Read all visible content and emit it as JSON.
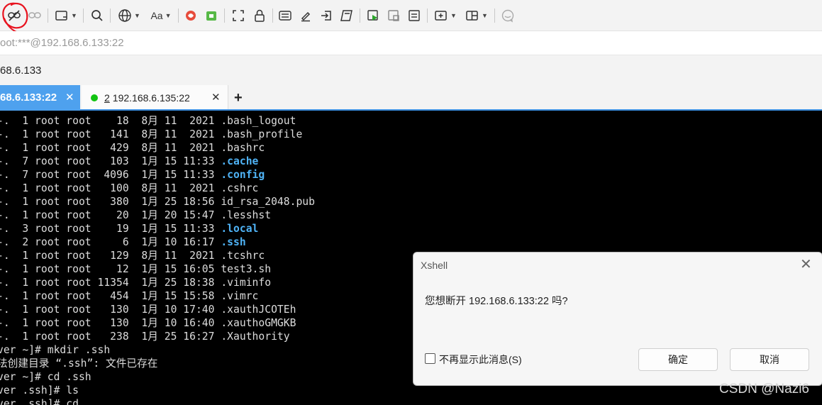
{
  "toolbar": {
    "font_button_label": "Aa"
  },
  "address_bar": {
    "text": "oot:***@192.168.6.133:22"
  },
  "host_bar": {
    "text": "68.6.133"
  },
  "tabs": [
    {
      "label": "68.6.133:22",
      "close": "✕"
    },
    {
      "index": "2",
      "label": "192.168.6.135:22",
      "close": "✕"
    }
  ],
  "new_tab": "+",
  "terminal": {
    "lines": [
      "-.  1 root root    18  8月 11  2021 .bash_logout",
      "-.  1 root root   141  8月 11  2021 .bash_profile",
      "-.  1 root root   429  8月 11  2021 .bashrc",
      "-.  7 root root   103  1月 15 11:33 ",
      "-.  7 root root  4096  1月 15 11:33 ",
      "-.  1 root root   100  8月 11  2021 .cshrc",
      "-.  1 root root   380  1月 25 18:56 id_rsa_2048.pub",
      "-.  1 root root    20  1月 20 15:47 .lesshst",
      "-.  3 root root    19  1月 15 11:33 ",
      "-.  2 root root     6  1月 10 16:17 ",
      "-.  1 root root   129  8月 11  2021 .tcshrc",
      "-.  1 root root    12  1月 15 16:05 test3.sh",
      "-.  1 root root 11354  1月 25 18:38 .viminfo",
      "-.  1 root root   454  1月 15 15:58 .vimrc",
      "-.  1 root root   130  1月 10 17:40 .xauthJCOTEh",
      "-.  1 root root   130  1月 10 16:40 .xauthoGMGKB",
      "-.  1 root root   238  1月 25 16:27 .Xauthority",
      "ver ~]# mkdir .ssh",
      "法创建目录 “.ssh”: 文件已存在",
      "ver ~]# cd .ssh",
      "ver .ssh]# ls",
      "ver .ssh]# cd"
    ],
    "dir_names": [
      ".cache",
      ".config",
      ".local",
      ".ssh"
    ]
  },
  "dialog": {
    "title": "Xshell",
    "close": "✕",
    "message": "您想断开 192.168.6.133:22 吗?",
    "checkbox_label": "不再显示此消息(S)",
    "ok_label": "确定",
    "cancel_label": "取消"
  },
  "watermark": "CSDN @Nazi6",
  "colors": {
    "active_tab": "#4ea1ee",
    "terminal_bg": "#000000",
    "dir_color": "#4fb3f6",
    "status_dot": "#11c311",
    "annotation": "#e8131f"
  }
}
